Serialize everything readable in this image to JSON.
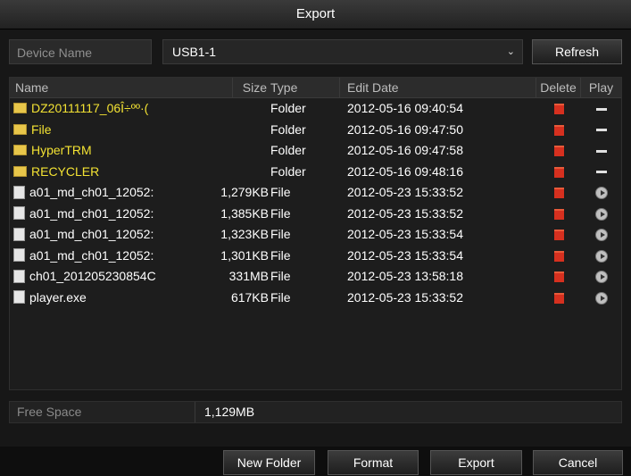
{
  "window": {
    "title": "Export"
  },
  "device": {
    "label": "Device Name",
    "selected": "USB1-1",
    "refresh_label": "Refresh"
  },
  "table": {
    "headers": {
      "name": "Name",
      "size": "Size",
      "type": "Type",
      "date": "Edit Date",
      "delete": "Delete",
      "play": "Play"
    },
    "rows": [
      {
        "name": "DZ20111117_06Î÷ºº·(",
        "size": "",
        "type": "Folder",
        "date": "2012-05-16 09:40:54",
        "kind": "folder",
        "play_icon": "dash-icon"
      },
      {
        "name": "File",
        "size": "",
        "type": "Folder",
        "date": "2012-05-16 09:47:50",
        "kind": "folder",
        "play_icon": "dash-icon"
      },
      {
        "name": "HyperTRM",
        "size": "",
        "type": "Folder",
        "date": "2012-05-16 09:47:58",
        "kind": "folder",
        "play_icon": "dash-icon"
      },
      {
        "name": "RECYCLER",
        "size": "",
        "type": "Folder",
        "date": "2012-05-16 09:48:16",
        "kind": "folder",
        "play_icon": "dash-icon"
      },
      {
        "name": "a01_md_ch01_12052:",
        "size": "1,279KB",
        "type": "File",
        "date": "2012-05-23 15:33:52",
        "kind": "file",
        "play_icon": "play-icon"
      },
      {
        "name": "a01_md_ch01_12052:",
        "size": "1,385KB",
        "type": "File",
        "date": "2012-05-23 15:33:52",
        "kind": "file",
        "play_icon": "play-icon"
      },
      {
        "name": "a01_md_ch01_12052:",
        "size": "1,323KB",
        "type": "File",
        "date": "2012-05-23 15:33:54",
        "kind": "file",
        "play_icon": "play-icon"
      },
      {
        "name": "a01_md_ch01_12052:",
        "size": "1,301KB",
        "type": "File",
        "date": "2012-05-23 15:33:54",
        "kind": "file",
        "play_icon": "play-icon"
      },
      {
        "name": "ch01_201205230854C",
        "size": "331MB",
        "type": "File",
        "date": "2012-05-23 13:58:18",
        "kind": "file",
        "play_icon": "play-icon"
      },
      {
        "name": "player.exe",
        "size": "617KB",
        "type": "File",
        "date": "2012-05-23 15:33:52",
        "kind": "file",
        "play_icon": "play-icon"
      }
    ]
  },
  "free_space": {
    "label": "Free Space",
    "value": "1,129MB"
  },
  "footer": {
    "new_folder": "New Folder",
    "format": "Format",
    "export": "Export",
    "cancel": "Cancel"
  },
  "colors": {
    "folder_text": "#f3e233",
    "delete_icon": "#d6301f"
  }
}
